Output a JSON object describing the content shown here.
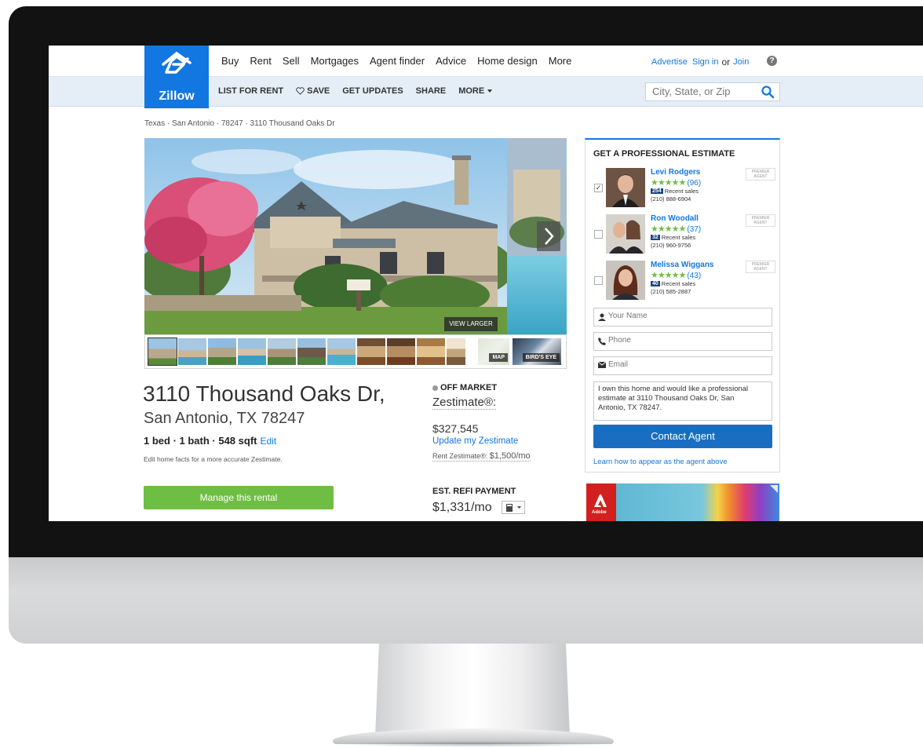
{
  "site": {
    "logo_text": "Zillow",
    "brand_color": "#1277e1"
  },
  "nav": {
    "items": [
      "Buy",
      "Rent",
      "Sell",
      "Mortgages",
      "Agent finder",
      "Advice",
      "Home design",
      "More"
    ],
    "advertise": "Advertise",
    "sign_in": "Sign in",
    "or": "or",
    "join": "Join"
  },
  "actions": {
    "list_for_rent": "LIST FOR RENT",
    "save": "SAVE",
    "get_updates": "GET UPDATES",
    "share": "SHARE",
    "more": "MORE"
  },
  "search": {
    "placeholder": "City, State, or Zip"
  },
  "breadcrumb": "Texas · San Antonio · 78247 · 3110 Thousand Oaks Dr",
  "gallery": {
    "view_larger": "VIEW LARGER",
    "map_label": "MAP",
    "birds_eye_label": "BIRD'S EYE"
  },
  "property": {
    "address_line1": "3110 Thousand Oaks Dr,",
    "address_line2": "San Antonio, TX 78247",
    "facts": "1 bed · 1 bath · 548 sqft",
    "edit": "Edit",
    "facts_note": "Edit home facts for a more accurate Zestimate.",
    "manage_button": "Manage this rental"
  },
  "valuation": {
    "status": "OFF MARKET",
    "zestimate_label": "Zestimate®:",
    "zestimate_value": "$327,545",
    "update_link": "Update my Zestimate",
    "rent_zestimate_label": "Rent Zestimate®:",
    "rent_zestimate_value": "$1,500/mo",
    "refi_label": "EST. REFI PAYMENT",
    "refi_value": "$1,331/mo"
  },
  "estimate": {
    "title": "GET A PROFESSIONAL ESTIMATE",
    "premier_label": "PREMIER AGENT",
    "agents": [
      {
        "name": "Levi Rodgers",
        "stars": "★★★★★",
        "reviews": "(96)",
        "sales": "254",
        "sales_label": "Recent sales",
        "phone": "(210) 888-6904",
        "checked": "✓"
      },
      {
        "name": "Ron Woodall",
        "stars": "★★★★★",
        "reviews": "(37)",
        "sales": "32",
        "sales_label": "Recent sales",
        "phone": "(210) 960-9756",
        "checked": ""
      },
      {
        "name": "Melissa Wiggans",
        "stars": "★★★★★",
        "reviews": "(43)",
        "sales": "40",
        "sales_label": "Recent sales",
        "phone": "(210) 585-2887",
        "checked": ""
      }
    ],
    "name_placeholder": "Your Name",
    "phone_placeholder": "Phone",
    "email_placeholder": "Email",
    "message": "I own this home and would like a professional estimate at 3110 Thousand Oaks Dr, San Antonio, TX 78247.",
    "contact_button": "Contact Agent",
    "learn_link": "Learn how to appear as the agent above"
  },
  "ad": {
    "brand": "Adobe"
  }
}
